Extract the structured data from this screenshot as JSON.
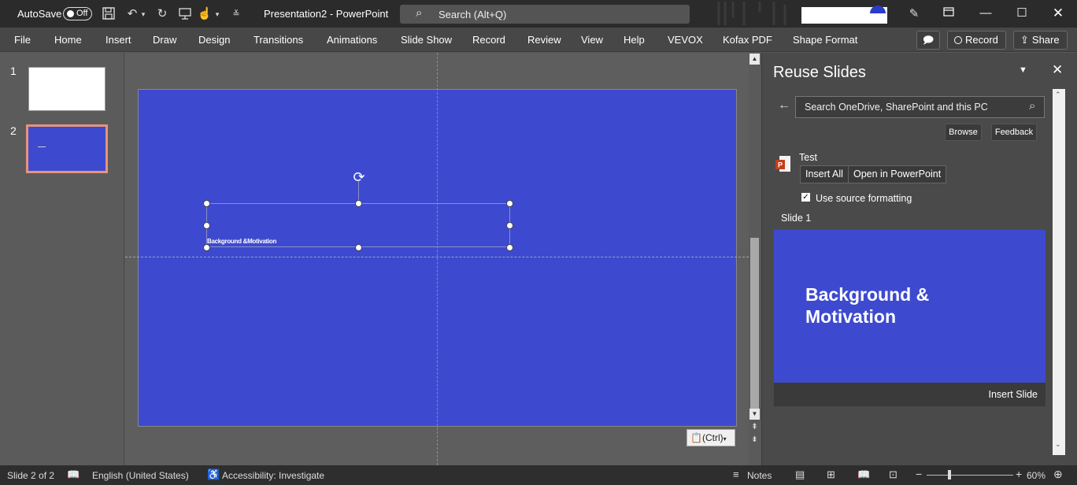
{
  "titlebar": {
    "autosave_label": "AutoSave",
    "autosave_state": "Off",
    "document_title": "Presentation2 - PowerPoint",
    "search_placeholder": "Search (Alt+Q)"
  },
  "ribbon": {
    "tabs": [
      "File",
      "Home",
      "Insert",
      "Draw",
      "Design",
      "Transitions",
      "Animations",
      "Slide Show",
      "Record",
      "Review",
      "View",
      "Help",
      "VEVOX",
      "Kofax PDF",
      "Shape Format"
    ],
    "record_label": "Record",
    "share_label": "Share"
  },
  "thumbnails": {
    "items": [
      {
        "number": "1"
      },
      {
        "number": "2"
      }
    ]
  },
  "slide": {
    "textbox_text": "Background &Motivation",
    "paste_options_label": "(Ctrl)"
  },
  "reuse_pane": {
    "title": "Reuse Slides",
    "search_placeholder": "Search OneDrive, SharePoint and this PC",
    "browse_label": "Browse",
    "feedback_label": "Feedback",
    "file_name": "Test",
    "insert_all_label": "Insert All",
    "open_label": "Open in PowerPoint",
    "use_source_label": "Use source formatting",
    "use_source_checked": true,
    "slide_label": "Slide 1",
    "preview_title_line1": "Background &",
    "preview_title_line2": "Motivation",
    "insert_slide_label": "Insert Slide"
  },
  "statusbar": {
    "slide_count": "Slide 2 of 2",
    "language": "English (United States)",
    "accessibility": "Accessibility: Investigate",
    "notes_label": "Notes",
    "zoom": "60%"
  },
  "colors": {
    "slide_blue": "#3d4acf",
    "selected_thumb_border": "#e8937a"
  }
}
